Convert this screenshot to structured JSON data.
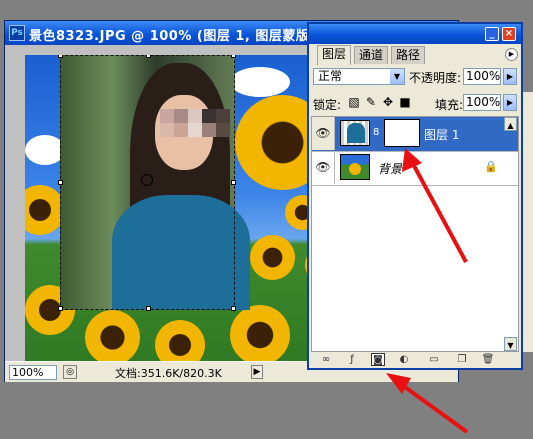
{
  "document": {
    "title": "景色8323.JPG @ 100% (图层 1, 图层蒙版",
    "zoom": "100%",
    "doc_info": "文档:351.6K/820.3K"
  },
  "layers_panel": {
    "tabs": [
      {
        "label": "图层",
        "active": true
      },
      {
        "label": "通道",
        "active": false
      },
      {
        "label": "路径",
        "active": false
      }
    ],
    "blend_mode": "正常",
    "opacity_label": "不透明度:",
    "opacity": "100%",
    "lock_label": "锁定:",
    "fill_label": "填充:",
    "fill": "100%",
    "layers": [
      {
        "name": "图层 1",
        "selected": true,
        "visible": true,
        "has_mask": true
      },
      {
        "name": "背景",
        "selected": false,
        "visible": true,
        "locked": true
      }
    ],
    "bottom_icons": [
      "link-icon",
      "layer-style-icon",
      "add-mask-icon",
      "adjustment-layer-icon",
      "new-group-icon",
      "new-layer-icon",
      "trash-icon"
    ]
  },
  "annotations": {
    "arrow_color": "#e81010"
  }
}
